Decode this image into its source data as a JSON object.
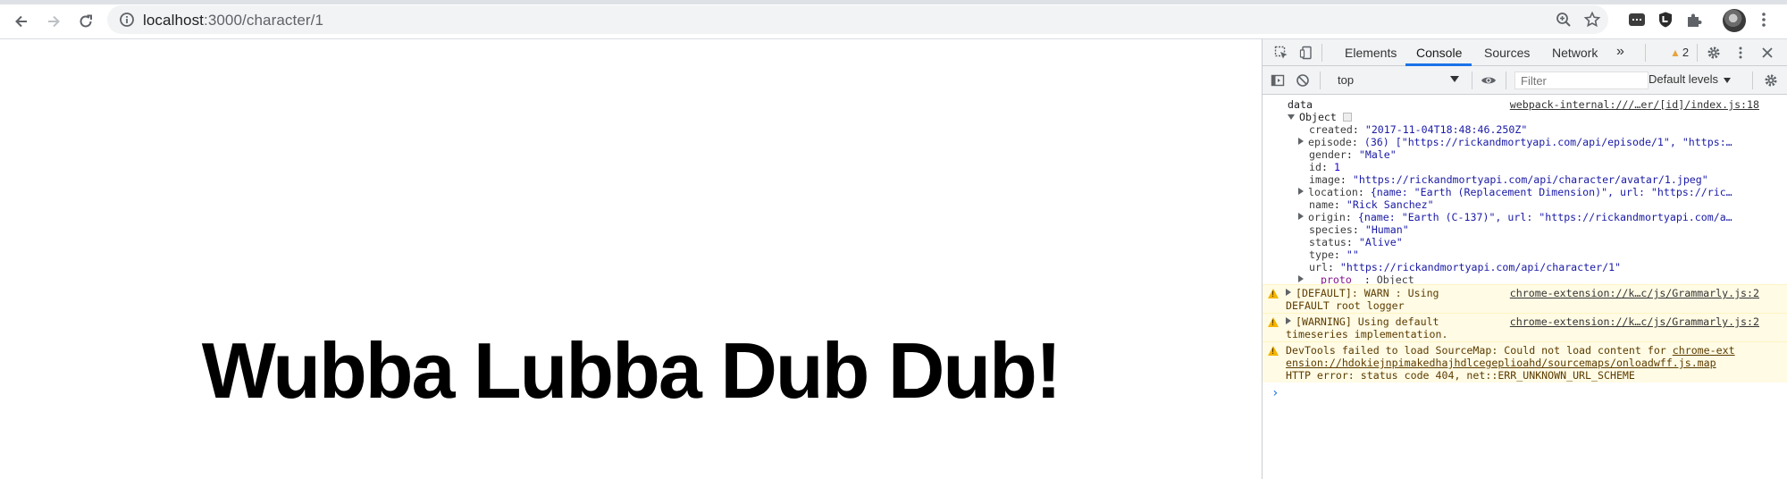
{
  "browser": {
    "url_host": "localhost",
    "url_path": ":3000/character/1"
  },
  "page": {
    "headline": "Wubba Lubba Dub Dub!"
  },
  "devtools": {
    "tabs": [
      {
        "label": "Elements"
      },
      {
        "label": "Console"
      },
      {
        "label": "Sources"
      },
      {
        "label": "Network"
      }
    ],
    "more_tabs": "»",
    "warning_count": "2",
    "context_select": "top",
    "filter_placeholder": "Filter",
    "levels_label": "Default levels",
    "console": {
      "log_label": "data",
      "log_source": "webpack-internal:///…er/[id]/index.js:18",
      "object_label": "Object",
      "props": [
        {
          "key": "created",
          "value": "\"2017-11-04T18:48:46.250Z\"",
          "expandable": false,
          "kind": "str"
        },
        {
          "key": "episode",
          "value": "(36) [\"https://rickandmortyapi.com/api/episode/1\", \"https:…",
          "expandable": true,
          "kind": "str"
        },
        {
          "key": "gender",
          "value": "\"Male\"",
          "expandable": false,
          "kind": "str"
        },
        {
          "key": "id",
          "value": "1",
          "expandable": false,
          "kind": "num"
        },
        {
          "key": "image",
          "value": "\"https://rickandmortyapi.com/api/character/avatar/1.jpeg\"",
          "expandable": false,
          "kind": "str"
        },
        {
          "key": "location",
          "value": "{name: \"Earth (Replacement Dimension)\", url: \"https://ric…",
          "expandable": true,
          "kind": "str"
        },
        {
          "key": "name",
          "value": "\"Rick Sanchez\"",
          "expandable": false,
          "kind": "str"
        },
        {
          "key": "origin",
          "value": "{name: \"Earth (C-137)\", url: \"https://rickandmortyapi.com/a…",
          "expandable": true,
          "kind": "str"
        },
        {
          "key": "species",
          "value": "\"Human\"",
          "expandable": false,
          "kind": "str"
        },
        {
          "key": "status",
          "value": "\"Alive\"",
          "expandable": false,
          "kind": "str"
        },
        {
          "key": "type",
          "value": "\"\"",
          "expandable": false,
          "kind": "str"
        },
        {
          "key": "url",
          "value": "\"https://rickandmortyapi.com/api/character/1\"",
          "expandable": false,
          "kind": "str"
        },
        {
          "key": "__proto__",
          "value": "Object",
          "expandable": true,
          "kind": "proto"
        }
      ],
      "warnings": [
        {
          "line1": "[DEFAULT]: WARN : Using",
          "line2": "DEFAULT root logger",
          "source": "chrome-extension://k…c/js/Grammarly.js:2"
        },
        {
          "line1": "[WARNING] Using default",
          "line2": "timeseries implementation.",
          "source": "chrome-extension://k…c/js/Grammarly.js:2"
        }
      ],
      "sourcemap_warning": {
        "line1": "DevTools failed to load SourceMap: Could not load content for ",
        "link1": "chrome-ext",
        "link2": "ension://hdokiejnpimakedhajhdlcegeplioahd/sourcemaps/onloadwff.js.map",
        "line3": "HTTP error: status code 404, net::ERR_UNKNOWN_URL_SCHEME"
      },
      "prompt": "›"
    }
  }
}
